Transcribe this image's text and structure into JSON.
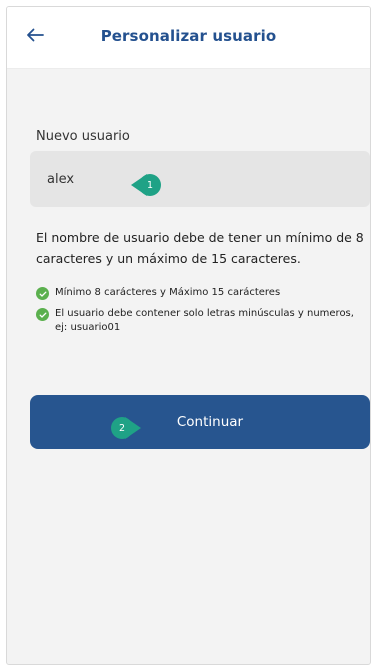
{
  "header": {
    "title": "Personalizar usuario",
    "back_icon": "arrow-left-icon"
  },
  "form": {
    "field_label": "Nuevo usuario",
    "username_value": "alex",
    "help_text": "El nombre de usuario debe de tener un mínimo de 8 caracteres y un máximo de 15 caracteres.",
    "rules": [
      {
        "text": "Mínimo 8 carácteres y Máximo 15 carácteres",
        "icon": "check-circle-icon"
      },
      {
        "text": "El usuario debe contener solo letras minúsculas y numeros, ej: usuario01",
        "icon": "check-circle-icon"
      }
    ],
    "continue_label": "Continuar"
  },
  "annotations": {
    "step1": "1",
    "step2": "2"
  },
  "colors": {
    "primary": "#27558f",
    "title": "#24518f",
    "success": "#5bb04e",
    "annotation": "#1fa286",
    "input_bg": "#e5e5e5",
    "screen_bg": "#f3f3f3"
  }
}
